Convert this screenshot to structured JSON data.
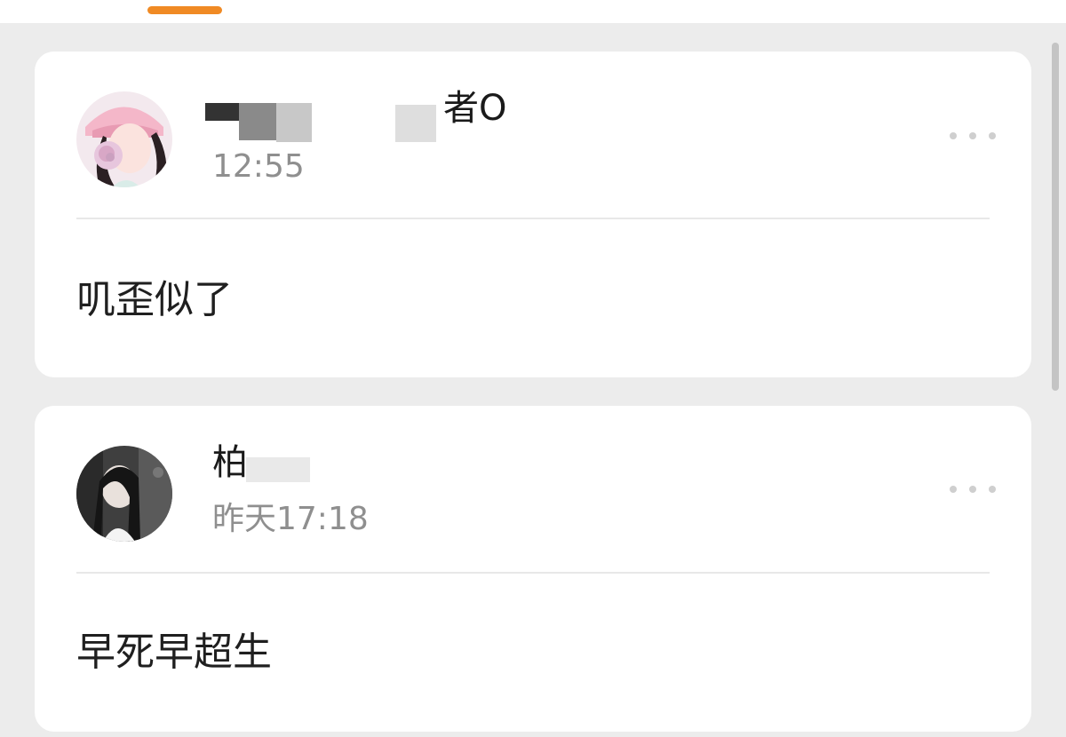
{
  "comments": [
    {
      "username": "者O",
      "timestamp": "12:55",
      "text": "叽歪似了",
      "avatar_icon": "user-avatar-girl-cap-icon"
    },
    {
      "username": "柏",
      "timestamp": "昨天17:18",
      "text": "早死早超生",
      "avatar_icon": "user-avatar-long-hair-icon"
    }
  ],
  "colors": {
    "accent": "#f08a24",
    "background": "#ececec",
    "card": "#ffffff",
    "timestamp": "#8f8f8f",
    "text": "#1f1f1f"
  }
}
